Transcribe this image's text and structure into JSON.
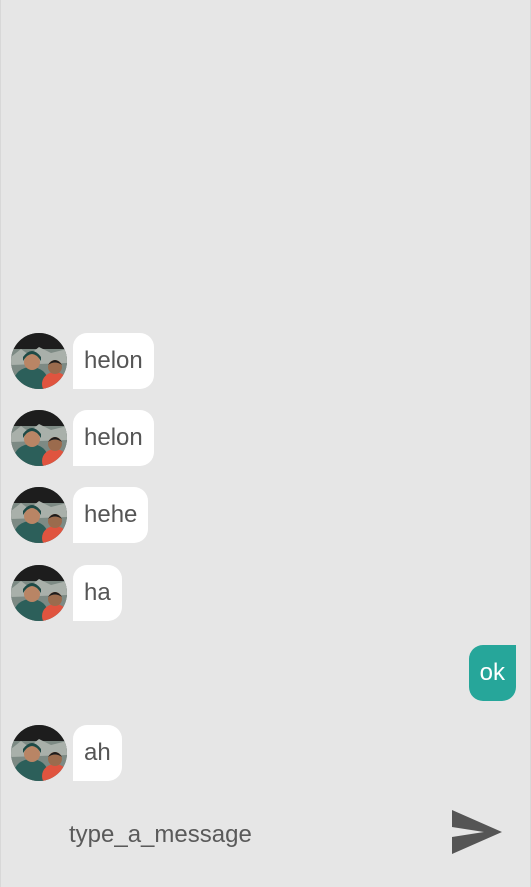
{
  "messages": [
    {
      "direction": "incoming",
      "text": "helon",
      "avatar": "user-avatar"
    },
    {
      "direction": "incoming",
      "text": "helon",
      "avatar": "user-avatar"
    },
    {
      "direction": "incoming",
      "text": "hehe",
      "avatar": "user-avatar"
    },
    {
      "direction": "incoming",
      "text": "ha",
      "avatar": "user-avatar"
    },
    {
      "direction": "outgoing",
      "text": "ok"
    },
    {
      "direction": "incoming",
      "text": "ah",
      "avatar": "user-avatar"
    }
  ],
  "composer": {
    "placeholder": "type_a_message",
    "value": "",
    "send_icon": "send-icon"
  },
  "colors": {
    "background": "#e6e6e6",
    "incoming_bubble": "#ffffff",
    "outgoing_bubble": "#26a69a",
    "incoming_text": "#555555",
    "outgoing_text": "#ffffff",
    "send_icon": "#555555"
  }
}
